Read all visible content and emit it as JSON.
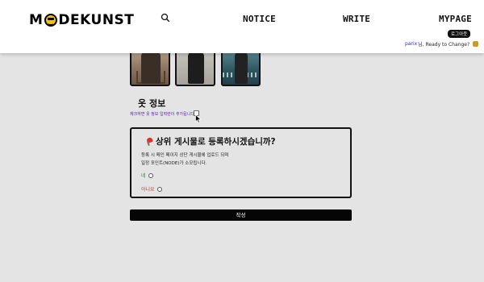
{
  "header": {
    "logo_text": "MODEKUNST",
    "logo_prefix": "M",
    "logo_suffix": "DEKUNST",
    "search_icon": "search-icon",
    "nav": [
      "NOTICE",
      "WRITE",
      "MYPAGE"
    ],
    "logout_label": "로그아웃",
    "user_name": "parix",
    "greeting_suffix": "님, Ready to Change?",
    "greeting_emoji_icon": "face-emoji-icon"
  },
  "photos": [
    {
      "name": "outfit-photo-1"
    },
    {
      "name": "outfit-photo-2"
    },
    {
      "name": "outfit-photo-3"
    }
  ],
  "clothing_info": {
    "title": "옷 정보",
    "check_hint": "체크하면 옷 정보 입력란이 추가됩니다",
    "checked": false
  },
  "promote_panel": {
    "title": "상위 게시물로 등록하시겠습니까?",
    "pin_icon": "pushpin-icon",
    "desc_line1": "등록 시 메인 페이지 상단 게시물에 업로드 되며",
    "desc_line2": "일정 포인트(NODE)가 소모됩니다.",
    "option_yes": "네",
    "option_no": "아니요",
    "yes_color": "#22884a",
    "no_color": "#cc3333"
  },
  "submit_label": "작성"
}
